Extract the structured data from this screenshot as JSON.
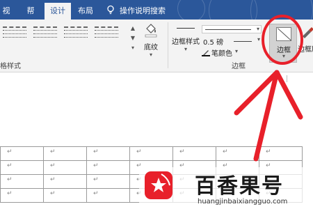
{
  "tabs": [
    {
      "label": "视图",
      "active": false
    },
    {
      "label": "帮助",
      "active": false
    },
    {
      "label": "设计",
      "active": true
    },
    {
      "label": "布局",
      "active": false
    }
  ],
  "search": {
    "label": "操作说明搜索",
    "icon": "lightbulb-icon"
  },
  "ribbon": {
    "table_styles_group_label": "格样式",
    "shading_label": "底纹",
    "border_styles_label": "边框样式",
    "pen_weight": "0.5 磅",
    "pen_color_label": "笔颜色",
    "borders_group_label": "边框",
    "borders_button_label": "边框",
    "border_painter_label": "边框刷"
  },
  "table": {
    "rows": 4,
    "cols": 7,
    "cell_mark": "↵"
  },
  "watermark": {
    "title": "百香果号",
    "url": "huangjinbaixiangguo.com"
  },
  "colors": {
    "tabbar": "#2b579a",
    "ribbon": "#f3f3f3",
    "annotation": "#e8202a"
  }
}
